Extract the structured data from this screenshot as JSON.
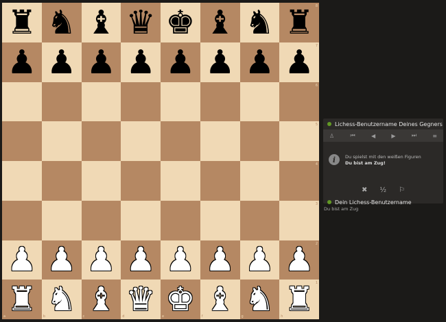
{
  "board": {
    "ranks": [
      "8",
      "7",
      "6",
      "5",
      "4",
      "3",
      "2",
      "1"
    ],
    "files": [
      "a",
      "b",
      "c",
      "d",
      "e",
      "f",
      "g",
      "h"
    ],
    "pieces": [
      [
        "r",
        "n",
        "b",
        "q",
        "k",
        "b",
        "n",
        "r"
      ],
      [
        "p",
        "p",
        "p",
        "p",
        "p",
        "p",
        "p",
        "p"
      ],
      [
        "",
        "",
        "",
        "",
        "",
        "",
        "",
        ""
      ],
      [
        "",
        "",
        "",
        "",
        "",
        "",
        "",
        ""
      ],
      [
        "",
        "",
        "",
        "",
        "",
        "",
        "",
        ""
      ],
      [
        "",
        "",
        "",
        "",
        "",
        "",
        "",
        ""
      ],
      [
        "P",
        "P",
        "P",
        "P",
        "P",
        "P",
        "P",
        "P"
      ],
      [
        "R",
        "N",
        "B",
        "Q",
        "K",
        "B",
        "N",
        "R"
      ]
    ],
    "light_color": "#f0d9b5",
    "dark_color": "#b58863"
  },
  "panel": {
    "opponent_name": "Lichess-Benutzername Deines Gegners",
    "player_name": "Dein Lichess-Benutzername",
    "controls": [
      "flip-board-icon",
      "first-move-icon",
      "prev-move-icon",
      "next-move-icon",
      "last-move-icon",
      "menu-icon"
    ],
    "message_line1": "Du spielst mit den weißen Figuren",
    "message_line2": "Du bist am Zug!",
    "resign_label": "✖",
    "draw_label": "½",
    "flag_label": "⚐"
  },
  "status_text": "Du bist am Zug"
}
